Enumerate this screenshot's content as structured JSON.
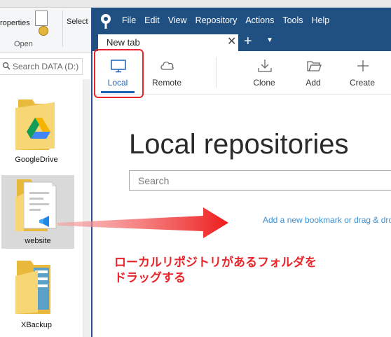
{
  "explorer": {
    "ribbon": {
      "properties_label": "roperties",
      "open_label": "Open",
      "select_label": "Select"
    },
    "search": {
      "placeholder": "Search DATA (D:)"
    },
    "items": [
      {
        "name": "GoogleDrive",
        "icon": "google-drive-folder-icon"
      },
      {
        "name": "website",
        "icon": "folder-vscode-icon",
        "selected": true
      },
      {
        "name": "XBackup",
        "icon": "folder-icon"
      }
    ]
  },
  "sourcetree": {
    "menu": [
      "File",
      "Edit",
      "View",
      "Repository",
      "Actions",
      "Tools",
      "Help"
    ],
    "tab": {
      "label": "New tab",
      "close": "✕"
    },
    "new_tab_symbol": "+",
    "tab_menu_symbol": "▼",
    "toolbar": {
      "local": "Local",
      "remote": "Remote",
      "clone": "Clone",
      "add": "Add",
      "create": "Create"
    },
    "heading": "Local repositories",
    "search_placeholder": "Search",
    "bookmark_hint": "Add a new bookmark or drag & drop"
  },
  "annotation": {
    "line1": "ローカルリポジトリがあるフォルダを",
    "line2": "ドラッグする",
    "color": "#e8252a"
  },
  "colors": {
    "titlebar": "#205081",
    "accent": "#1f62b5",
    "link": "#3d8fcf"
  }
}
